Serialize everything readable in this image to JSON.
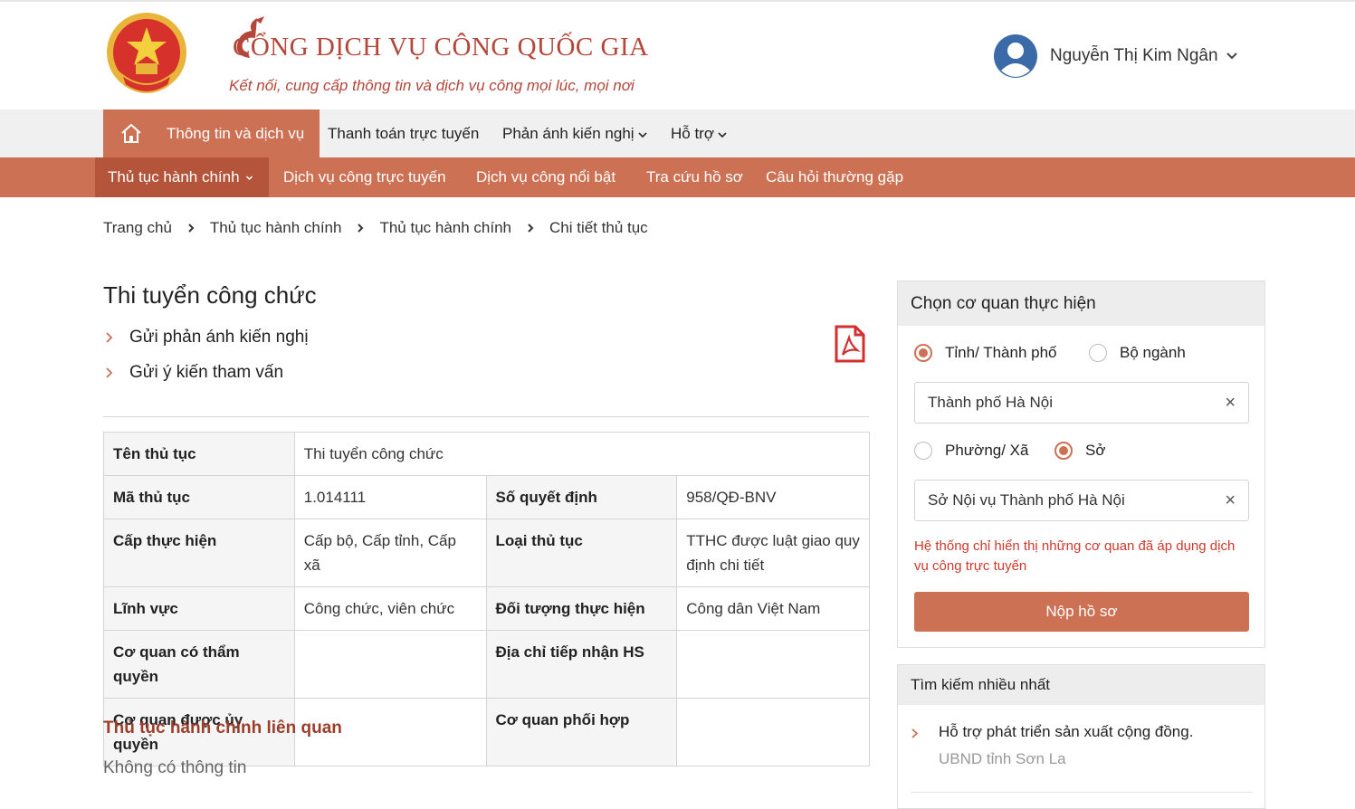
{
  "header": {
    "title": "CỔNG DỊCH VỤ CÔNG QUỐC GIA",
    "tagline": "Kết nối, cung cấp thông tin và dịch vụ công mọi lúc, mọi nơi",
    "user_name": "Nguyễn Thị Kim Ngân"
  },
  "main_nav": {
    "items": [
      "Thông tin và dịch vụ",
      "Thanh toán trực tuyến",
      "Phản ánh kiến nghị",
      "Hỗ trợ"
    ]
  },
  "sub_nav": {
    "items": [
      "Thủ tục hành chính",
      "Dịch vụ công trực tuyến",
      "Dịch vụ công nổi bật",
      "Tra cứu hồ sơ",
      "Câu hỏi thường gặp"
    ]
  },
  "breadcrumb": [
    "Trang chủ",
    "Thủ tục hành chính",
    "Thủ tục hành chính",
    "Chi tiết thủ tục"
  ],
  "procedure": {
    "title": "Thi tuyển công chức",
    "actions": [
      "Gửi phản ánh kiến nghị",
      "Gửi ý kiến tham vấn"
    ],
    "table": {
      "name_label": "Tên thủ tục",
      "name_value": "Thi tuyển công chức",
      "code_label": "Mã thủ tục",
      "code_value": "1.014111",
      "decision_label": "Số quyết định",
      "decision_value": "958/QĐ-BNV",
      "level_label": "Cấp thực hiện",
      "level_value": "Cấp bộ, Cấp tỉnh, Cấp xã",
      "type_label": "Loại thủ tục",
      "type_value": "TTHC được luật giao quy định chi tiết",
      "field_label": "Lĩnh vực",
      "field_value": "Công chức, viên chức",
      "subject_label": "Đối tượng thực hiện",
      "subject_value": "Công dân Việt Nam",
      "authority_label": "Cơ quan có thẩm quyền",
      "authority_value": "",
      "address_label": "Địa chỉ tiếp nhận HS",
      "address_value": "",
      "delegated_label": "Cơ quan được ủy quyền",
      "delegated_value": "",
      "coord_label": "Cơ quan phối hợp",
      "coord_value": ""
    },
    "related_title": "Thủ tục hành chính liên quan",
    "related_empty": "Không có thông tin"
  },
  "agency_panel": {
    "title": "Chọn cơ quan thực hiện",
    "radio_province": "Tỉnh/ Thành phố",
    "radio_ministry": "Bộ ngành",
    "province_value": "Thành phố Hà Nội",
    "radio_ward": "Phường/ Xã",
    "radio_department": "Sở",
    "department_value": "Sở Nội vụ Thành phố Hà Nội",
    "clear_symbol": "×",
    "note": "Hệ thống chỉ hiển thị những cơ quan đã áp dụng dịch vụ công trực tuyến",
    "submit_label": "Nộp hồ sơ"
  },
  "top_search": {
    "title": "Tìm kiếm nhiều nhất",
    "items": [
      {
        "name": "Hỗ trợ phát triển sản xuất cộng đồng.",
        "agency": "UBND tỉnh Sơn La"
      }
    ]
  },
  "colors": {
    "primary": "#cd7155",
    "primary_dark": "#b4553b",
    "brand_text": "#b4463a",
    "related_title": "#9b3f2c",
    "note_red": "#d0382b",
    "pdf_red": "#d32f2f"
  },
  "icons": [
    "national-emblem",
    "brand-logo-mark",
    "avatar-icon",
    "chevron-down-icon",
    "home-icon",
    "chevron-right-icon",
    "pdf-icon",
    "clear-icon"
  ]
}
